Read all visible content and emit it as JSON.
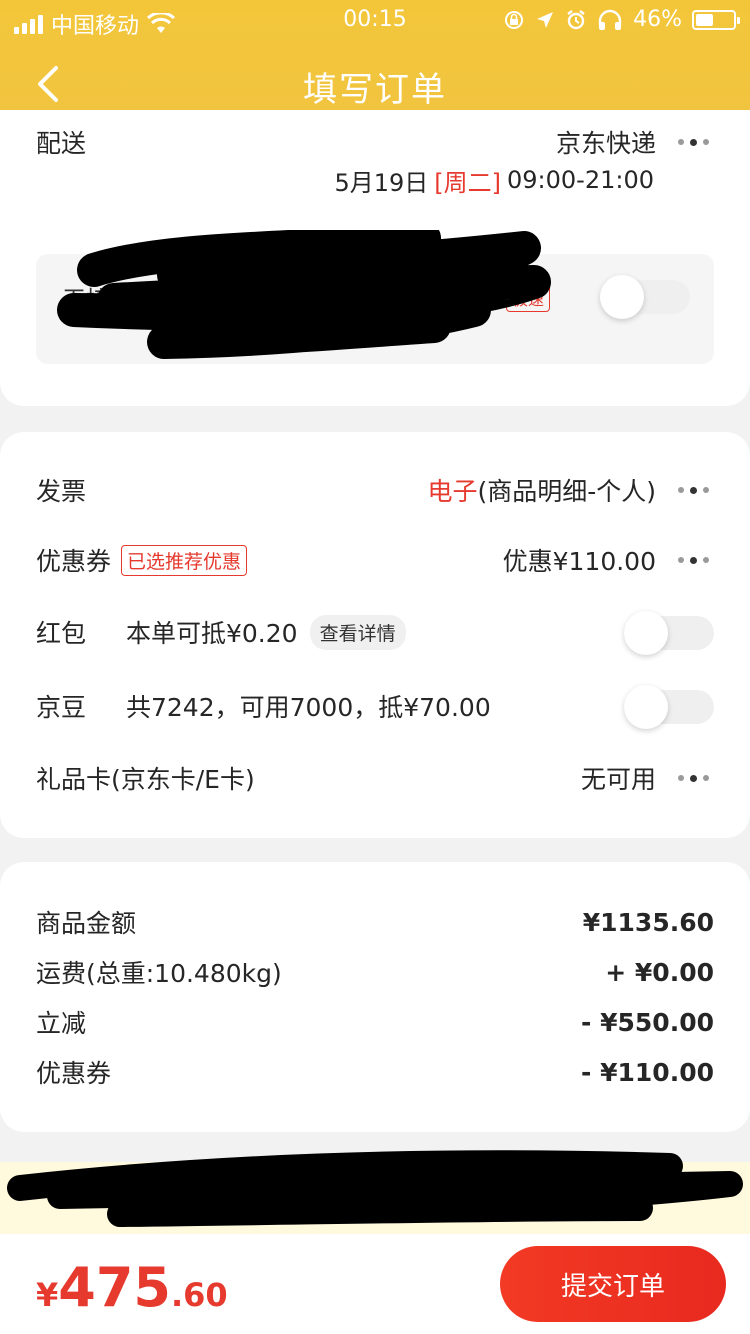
{
  "status_bar": {
    "carrier": "中国移动",
    "time": "00:15",
    "battery_percent": "46%",
    "battery_level": 0.46,
    "icons": [
      "signal-icon",
      "wifi-icon",
      "lock-rotation-icon",
      "location-icon",
      "alarm-icon",
      "headphones-icon",
      "battery-icon"
    ]
  },
  "nav": {
    "title": "填写订单",
    "back_icon": "chevron-left-icon"
  },
  "delivery": {
    "label": "配送",
    "method": "京东快递",
    "date": "5月19日",
    "weekday": "[周二]",
    "time_window": "09:00-21:00",
    "redacted_option_prefix": "无接",
    "redacted_option_badge": "极速"
  },
  "options": {
    "invoice": {
      "label": "发票",
      "type": "电子",
      "detail": "(商品明细-个人)"
    },
    "coupon": {
      "label": "优惠券",
      "tag": "已选推荐优惠",
      "value": "优惠¥110.00"
    },
    "red_packet": {
      "label": "红包",
      "desc": "本单可抵¥0.20",
      "link": "查看详情"
    },
    "jingdou": {
      "label": "京豆",
      "desc": "共7242，可用7000，抵¥70.00"
    },
    "gift_card": {
      "label": "礼品卡(京东卡/E卡)",
      "value": "无可用"
    }
  },
  "summary": {
    "goods_amount": {
      "label": "商品金额",
      "value": "¥1135.60"
    },
    "shipping": {
      "label": "运费(总重:10.480kg)",
      "value": "+ ¥0.00"
    },
    "instant_discount": {
      "label": "立减",
      "value": "- ¥550.00"
    },
    "coupon": {
      "label": "优惠券",
      "value": "- ¥110.00"
    }
  },
  "footer": {
    "currency": "¥",
    "total_int": "475",
    "total_dec": ".60",
    "submit_label": "提交订单"
  },
  "colors": {
    "header": "#f3c63a",
    "accent_red": "#e63a2f",
    "toggle_off": "#efefef"
  }
}
